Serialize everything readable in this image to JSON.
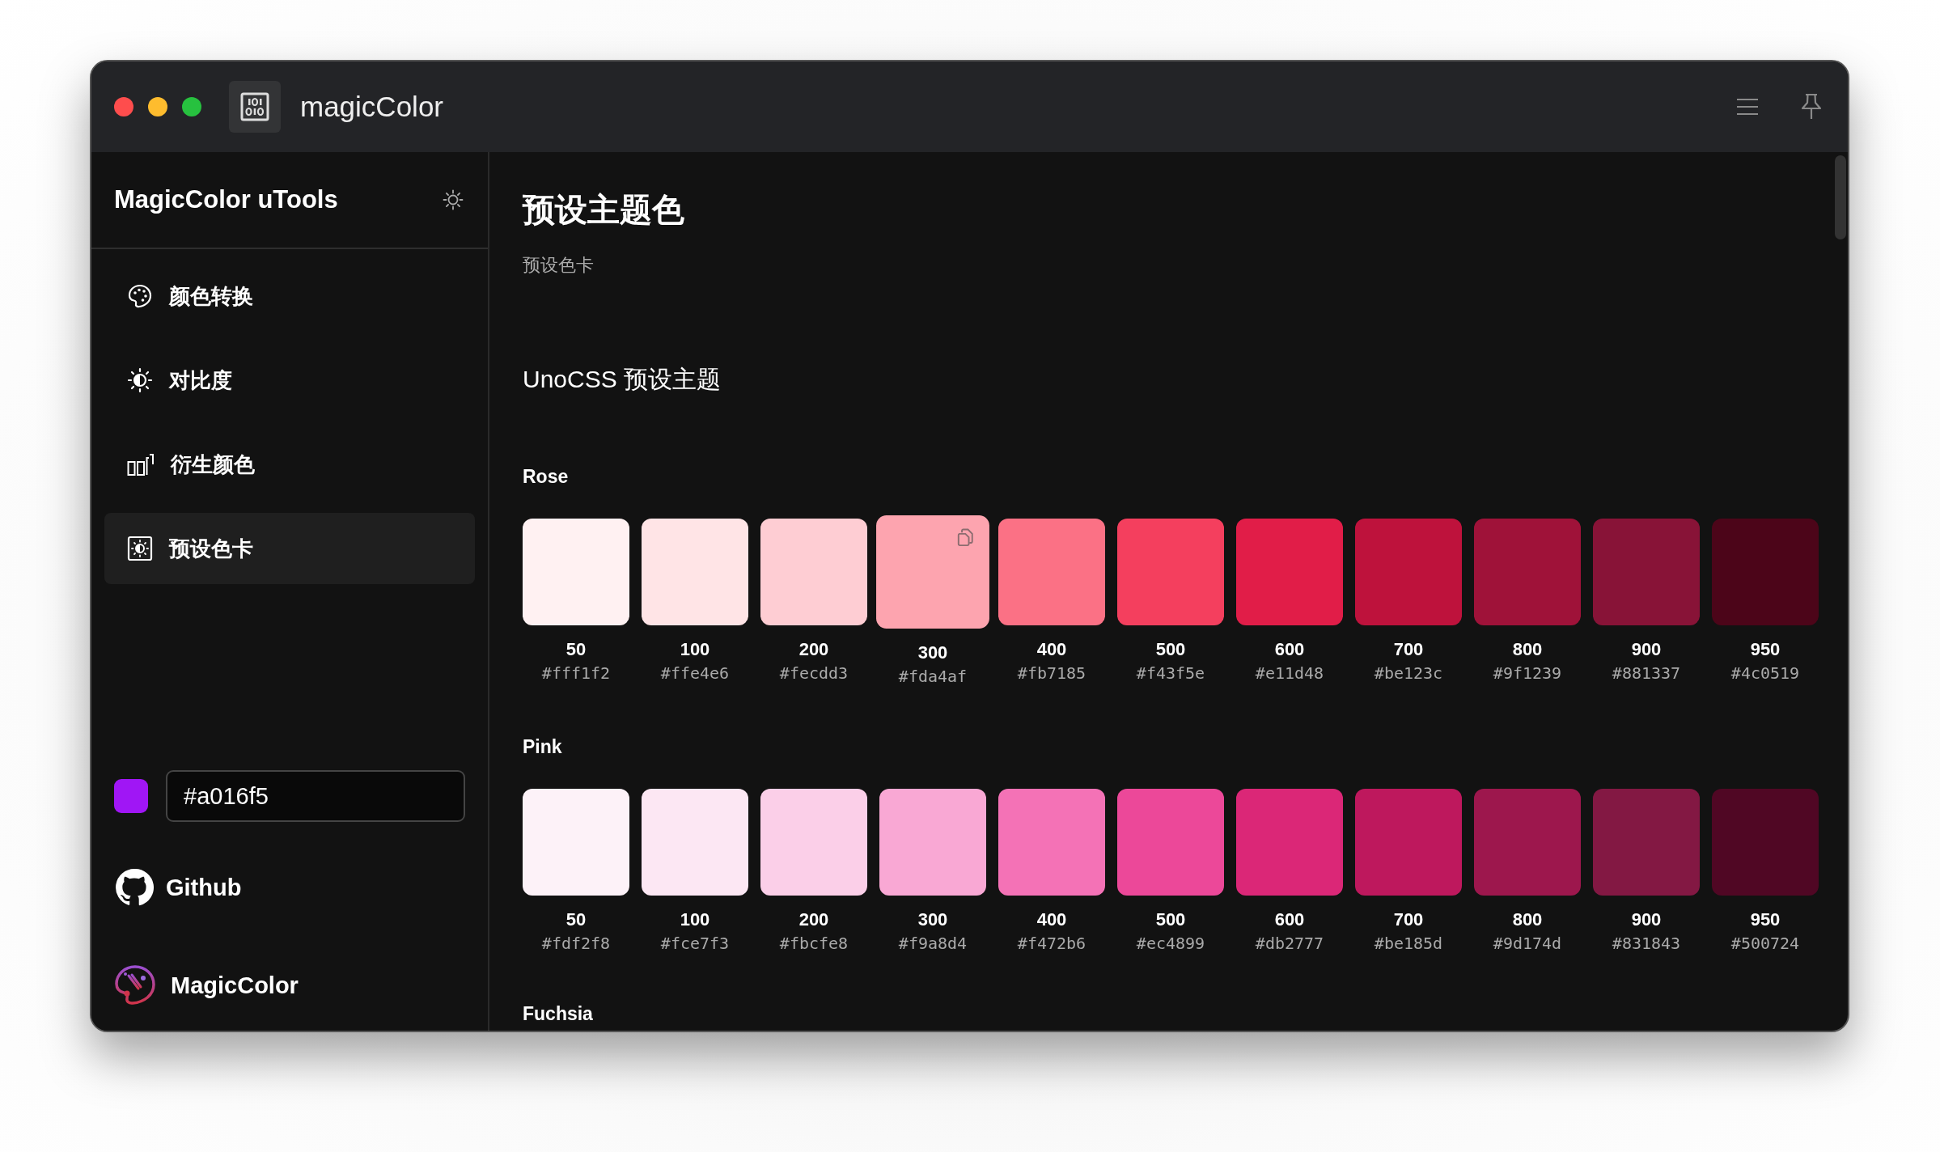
{
  "window": {
    "title": "magicColor"
  },
  "sidebar": {
    "title": "MagicColor uTools",
    "items": [
      {
        "label": "颜色转换",
        "kind": "palette",
        "selected": false
      },
      {
        "label": "对比度",
        "kind": "contrast",
        "selected": false
      },
      {
        "label": "衍生颜色",
        "kind": "derive",
        "selected": false
      },
      {
        "label": "预设色卡",
        "kind": "preset",
        "selected": true
      }
    ],
    "color_input": {
      "color": "#a016f5",
      "value": "#a016f5"
    },
    "links": [
      {
        "label": "Github",
        "kind": "github"
      },
      {
        "label": "MagicColor",
        "kind": "magiccolor"
      }
    ]
  },
  "page": {
    "title": "预设主题色",
    "subtitle": "预设色卡",
    "section": "UnoCSS 预设主题",
    "palettes": [
      {
        "name": "Rose",
        "swatches": [
          {
            "shade": "50",
            "hex": "#fff1f2",
            "color": "#fff1f2",
            "hovered": false
          },
          {
            "shade": "100",
            "hex": "#ffe4e6",
            "color": "#ffe4e6",
            "hovered": false
          },
          {
            "shade": "200",
            "hex": "#fecdd3",
            "color": "#fecdd3",
            "hovered": false
          },
          {
            "shade": "300",
            "hex": "#fda4af",
            "color": "#fda4af",
            "hovered": true
          },
          {
            "shade": "400",
            "hex": "#fb7185",
            "color": "#fb7185",
            "hovered": false
          },
          {
            "shade": "500",
            "hex": "#f43f5e",
            "color": "#f43f5e",
            "hovered": false
          },
          {
            "shade": "600",
            "hex": "#e11d48",
            "color": "#e11d48",
            "hovered": false
          },
          {
            "shade": "700",
            "hex": "#be123c",
            "color": "#be123c",
            "hovered": false
          },
          {
            "shade": "800",
            "hex": "#9f1239",
            "color": "#9f1239",
            "hovered": false
          },
          {
            "shade": "900",
            "hex": "#881337",
            "color": "#881337",
            "hovered": false
          },
          {
            "shade": "950",
            "hex": "#4c0519",
            "color": "#4c0519",
            "hovered": false
          }
        ]
      },
      {
        "name": "Pink",
        "swatches": [
          {
            "shade": "50",
            "hex": "#fdf2f8",
            "color": "#fdf2f8",
            "hovered": false
          },
          {
            "shade": "100",
            "hex": "#fce7f3",
            "color": "#fce7f3",
            "hovered": false
          },
          {
            "shade": "200",
            "hex": "#fbcfe8",
            "color": "#fbcfe8",
            "hovered": false
          },
          {
            "shade": "300",
            "hex": "#f9a8d4",
            "color": "#f9a8d4",
            "hovered": false
          },
          {
            "shade": "400",
            "hex": "#f472b6",
            "color": "#f472b6",
            "hovered": false
          },
          {
            "shade": "500",
            "hex": "#ec4899",
            "color": "#ec4899",
            "hovered": false
          },
          {
            "shade": "600",
            "hex": "#db2777",
            "color": "#db2777",
            "hovered": false
          },
          {
            "shade": "700",
            "hex": "#be185d",
            "color": "#be185d",
            "hovered": false
          },
          {
            "shade": "800",
            "hex": "#9d174d",
            "color": "#9d174d",
            "hovered": false
          },
          {
            "shade": "900",
            "hex": "#831843",
            "color": "#831843",
            "hovered": false
          },
          {
            "shade": "950",
            "hex": "#500724",
            "color": "#500724",
            "hovered": false
          }
        ]
      },
      {
        "name": "Fuchsia"
      }
    ]
  }
}
